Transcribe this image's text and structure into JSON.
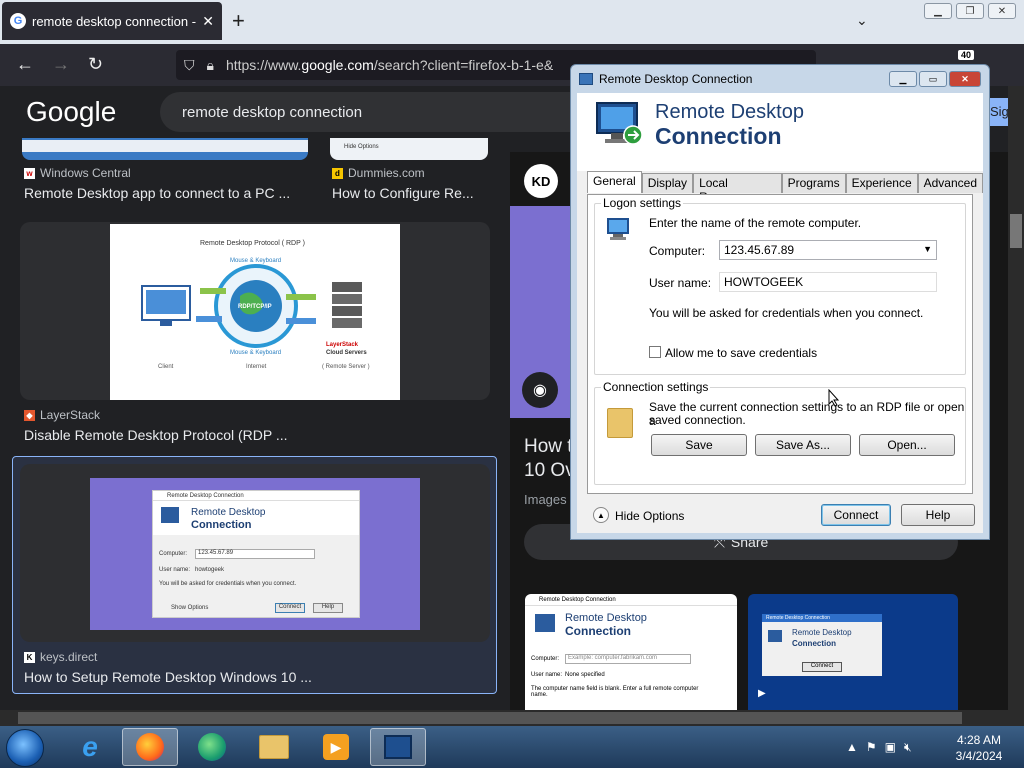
{
  "browser": {
    "tab_title": "remote desktop connection - G",
    "tab_close": "✕",
    "new_tab": "+",
    "tab_list": "⌄",
    "url_prefix": "https://www.",
    "url_domain": "google.com",
    "url_rest": "/search?client=firefox-b-1-e&",
    "badge": "40"
  },
  "google": {
    "logo": "Google",
    "query": "remote desktop connection",
    "sign_in_partial": "Sig"
  },
  "results": [
    {
      "source": "Windows Central",
      "caption": "Remote Desktop app to connect to a PC ..."
    },
    {
      "source": "Dummies.com",
      "caption": "How to Configure Re..."
    },
    {
      "source": "LayerStack",
      "caption": "Disable Remote Desktop Protocol (RDP ..."
    },
    {
      "source": "keys.direct",
      "caption": "How to Setup Remote Desktop Windows 10 ..."
    }
  ],
  "rdp_image": {
    "title": "Remote Desktop Protocol ( RDP )",
    "mouse_keyboard": "Mouse & Keyboard",
    "protocol": "RDP/TCP/IP",
    "client": "Client",
    "internet": "Internet",
    "layerstack": "LayerStack",
    "cloud_servers": "Cloud Servers",
    "remote_server": "( Remote Server )"
  },
  "panel": {
    "kd": "KD",
    "heading_partial_1": "How t",
    "heading_partial_2": "10 Ov",
    "images_label": "Images",
    "share": "Share"
  },
  "dialog": {
    "title": "Remote Desktop Connection",
    "banner_line1": "Remote Desktop",
    "banner_line2": "Connection",
    "tabs": [
      "General",
      "Display",
      "Local Resources",
      "Programs",
      "Experience",
      "Advanced"
    ],
    "logon_settings": "Logon settings",
    "enter_name": "Enter the name of the remote computer.",
    "computer_label": "Computer:",
    "computer_value": "123.45.67.89",
    "username_label": "User name:",
    "username_value": "HOWTOGEEK",
    "credentials_note": "You will be asked for credentials when you connect.",
    "save_credentials": "Allow me to save credentials",
    "connection_settings": "Connection settings",
    "save_line1": "Save the current connection settings to an RDP file or open a",
    "save_line2": "saved connection.",
    "save_btn": "Save",
    "save_as_btn": "Save As...",
    "open_btn": "Open...",
    "hide_options": "Hide Options",
    "connect_btn": "Connect",
    "help_btn": "Help"
  },
  "thumb_dialog": {
    "title": "Remote Desktop Connection",
    "line1": "Remote Desktop",
    "line2": "Connection",
    "computer_label": "Computer:",
    "computer_value": "123.45.67.89",
    "user_label": "User name:",
    "user_value": "howtogeek",
    "note": "You will be asked for credentials when you connect.",
    "show_options": "Show Options",
    "connect": "Connect",
    "help": "Help"
  },
  "bottom_thumb1": {
    "title": "Remote Desktop Connection",
    "line1": "Remote Desktop",
    "line2": "Connection",
    "computer_label": "Computer:",
    "computer_value": "Example: computer.fabrikam.com",
    "user_label": "User name:",
    "user_value": "None specified",
    "note": "The computer name field is blank. Enter a full remote computer name."
  },
  "bottom_thumb2": {
    "title": "Remote Desktop Connection",
    "line1": "Remote Desktop",
    "line2": "Connection",
    "connect": "Connect"
  },
  "taskbar": {
    "time": "4:28 AM",
    "date": "3/4/2024"
  },
  "colors": {
    "accent": "#8ab4f8",
    "purple": "#7b6fd0",
    "dialog_frame": "#c7d7e8"
  }
}
